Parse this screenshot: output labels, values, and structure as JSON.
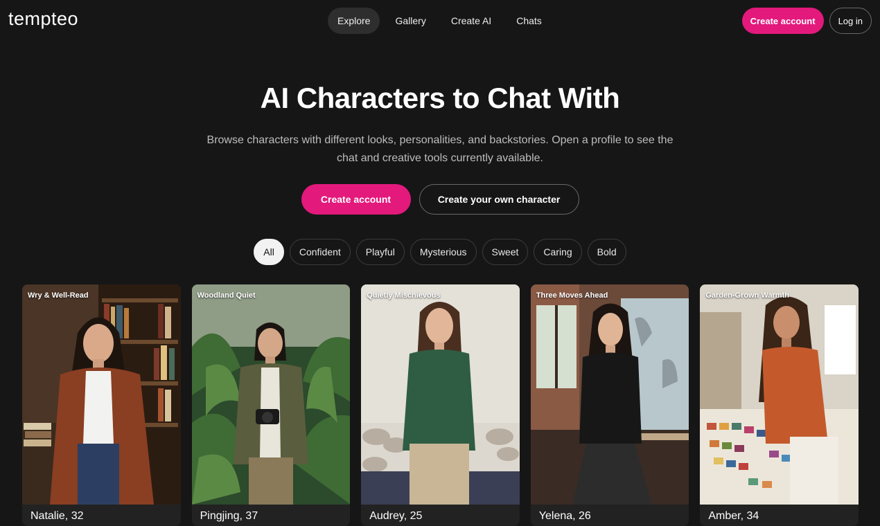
{
  "brand": {
    "logo_text": "tempteo"
  },
  "nav": {
    "items": [
      {
        "label": "Explore",
        "active": true
      },
      {
        "label": "Gallery"
      },
      {
        "label": "Create AI"
      },
      {
        "label": "Chats"
      }
    ]
  },
  "header_actions": {
    "create_account": "Create account",
    "login": "Log in"
  },
  "hero": {
    "title": "AI Characters to Chat With",
    "subtitle": "Browse characters with different looks, personalities, and backstories. Open a profile to see the chat and creative tools currently available.",
    "primary_cta": "Create account",
    "secondary_cta": "Create your own character"
  },
  "filters": [
    "All",
    "Confident",
    "Playful",
    "Mysterious",
    "Sweet",
    "Caring",
    "Bold"
  ],
  "active_filter": "All",
  "characters": [
    {
      "tag": "Wry & Well-Read",
      "name": "Natalie, 32"
    },
    {
      "tag": "Woodland Quiet",
      "name": "Pingjing, 37"
    },
    {
      "tag": "Quietly Mischievous",
      "name": "Audrey, 25"
    },
    {
      "tag": "Three Moves Ahead",
      "name": "Yelena, 26"
    },
    {
      "tag": "Garden-Grown Warmth",
      "name": "Amber, 34"
    }
  ],
  "colors": {
    "accent": "#e3197c",
    "background": "#161616",
    "chip_active": "#f2f2f2"
  }
}
